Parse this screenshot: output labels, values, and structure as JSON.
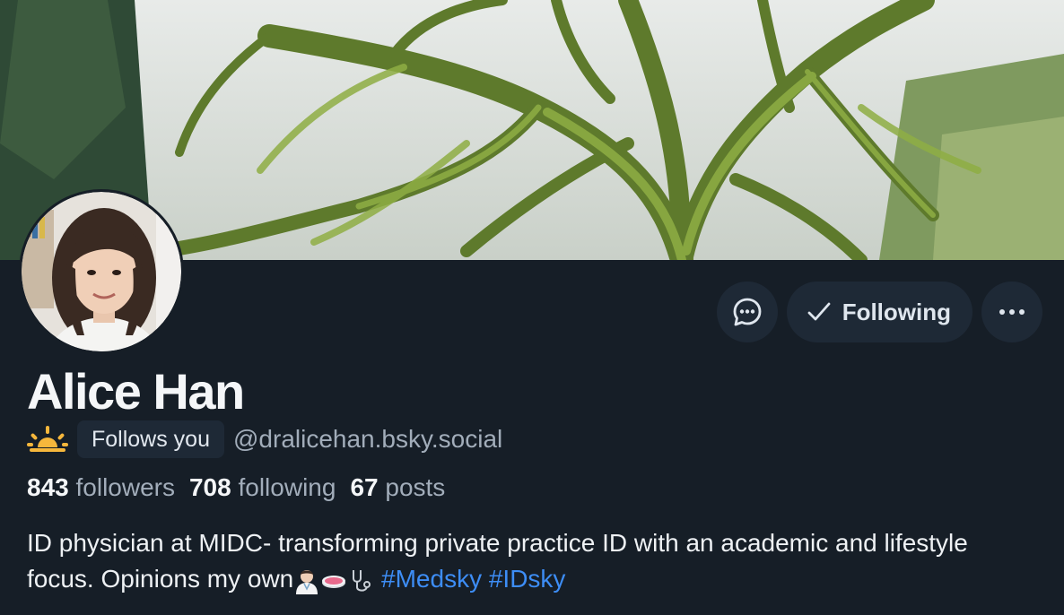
{
  "profile": {
    "display_name": "Alice Han",
    "status_emoji_icon": "sunrise-icon",
    "follows_you_label": "Follows you",
    "handle": "@dralicehan.bsky.social",
    "stats": {
      "followers_count": "843",
      "followers_label": "followers",
      "following_count": "708",
      "following_label": "following",
      "posts_count": "67",
      "posts_label": "posts"
    },
    "bio_text": "ID physician at MIDC- transforming private practice ID with an academic and lifestyle focus. Opinions my own",
    "bio_emoji_icons": [
      "doctor-icon",
      "petri-dish-icon",
      "stethoscope-icon"
    ],
    "hashtags": [
      "#Medsky",
      "#IDsky"
    ]
  },
  "actions": {
    "message_icon": "chat-bubble-icon",
    "following_label": "Following",
    "following_icon": "checkmark-icon",
    "more_icon": "ellipsis-icon"
  },
  "colors": {
    "background": "#161e27",
    "button_bg": "#1e2936",
    "hashtag": "#3d8df5",
    "muted_text": "#a2adba"
  }
}
